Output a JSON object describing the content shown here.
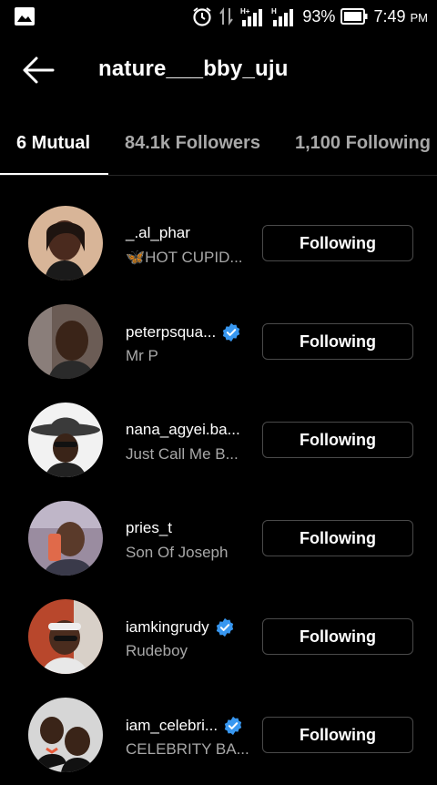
{
  "status_bar": {
    "battery": "93%",
    "time": "7:49",
    "ampm": "PM",
    "signal_label_1": "H+",
    "signal_label_2": "H"
  },
  "header": {
    "title": "nature___bby_uju"
  },
  "tabs": [
    {
      "label": "6 Mutual"
    },
    {
      "label": "84.1k Followers"
    },
    {
      "label": "1,100 Following"
    }
  ],
  "users": [
    {
      "username": "_.al_phar",
      "subtitle": "🦋HOT CUPID...",
      "verified": false,
      "button": "Following",
      "avatar_color": "#c9a58a"
    },
    {
      "username": "peterpsqua...",
      "subtitle": "Mr P",
      "verified": true,
      "button": "Following",
      "avatar_color": "#6a5a52"
    },
    {
      "username": "nana_agyei.ba...",
      "subtitle": "Just Call Me B...",
      "verified": false,
      "button": "Following",
      "avatar_color": "#e8e8e8"
    },
    {
      "username": "pries_t",
      "subtitle": "Son Of Joseph",
      "verified": false,
      "button": "Following",
      "avatar_color": "#8a7a8c"
    },
    {
      "username": "iamkingrudy",
      "subtitle": "Rudeboy",
      "verified": true,
      "button": "Following",
      "avatar_color": "#b84a2e"
    },
    {
      "username": "iam_celebri...",
      "subtitle": "CELEBRITY BA...",
      "verified": true,
      "button": "Following",
      "avatar_color": "#cfcfcf"
    }
  ],
  "colors": {
    "background": "#000000",
    "verified_blue": "#3897f0",
    "muted_text": "#a8a8a8",
    "button_border": "#4a4a4a"
  }
}
